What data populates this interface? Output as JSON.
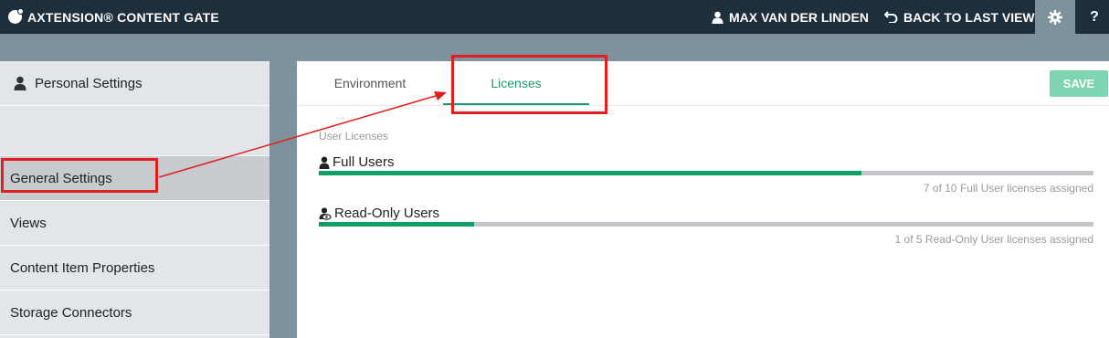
{
  "header": {
    "app_title": "AXTENSION® CONTENT GATE",
    "user_name": "MAX VAN DER LINDEN",
    "back_label": "BACK TO LAST VIEW",
    "help_label": "?",
    "icons": [
      "logo-icon",
      "user-icon",
      "back-arrow-icon",
      "gear-icon"
    ]
  },
  "sidebar": {
    "personal_label": "Personal Settings",
    "items": [
      {
        "label": "General Settings",
        "active": true
      },
      {
        "label": "Views"
      },
      {
        "label": "Content Item Properties"
      },
      {
        "label": "Storage Connectors"
      }
    ]
  },
  "main": {
    "tabs": [
      {
        "label": "Environment"
      },
      {
        "label": "Licenses",
        "active": true
      }
    ],
    "save_label": "SAVE",
    "section_label": "User Licenses",
    "licenses": [
      {
        "label": "Full Users",
        "assigned": 7,
        "total": 10,
        "note": "7 of 10 Full User licenses assigned"
      },
      {
        "label": "Read-Only Users",
        "assigned": 1,
        "total": 5,
        "note": "1 of 5 Read-Only User licenses assigned"
      }
    ]
  },
  "colors": {
    "topbar": "#1f2e3b",
    "accent": "#1a9b6d",
    "bar_fill": "#0fa06a",
    "save": "#7fd4b2",
    "annotation": "#e02020"
  }
}
